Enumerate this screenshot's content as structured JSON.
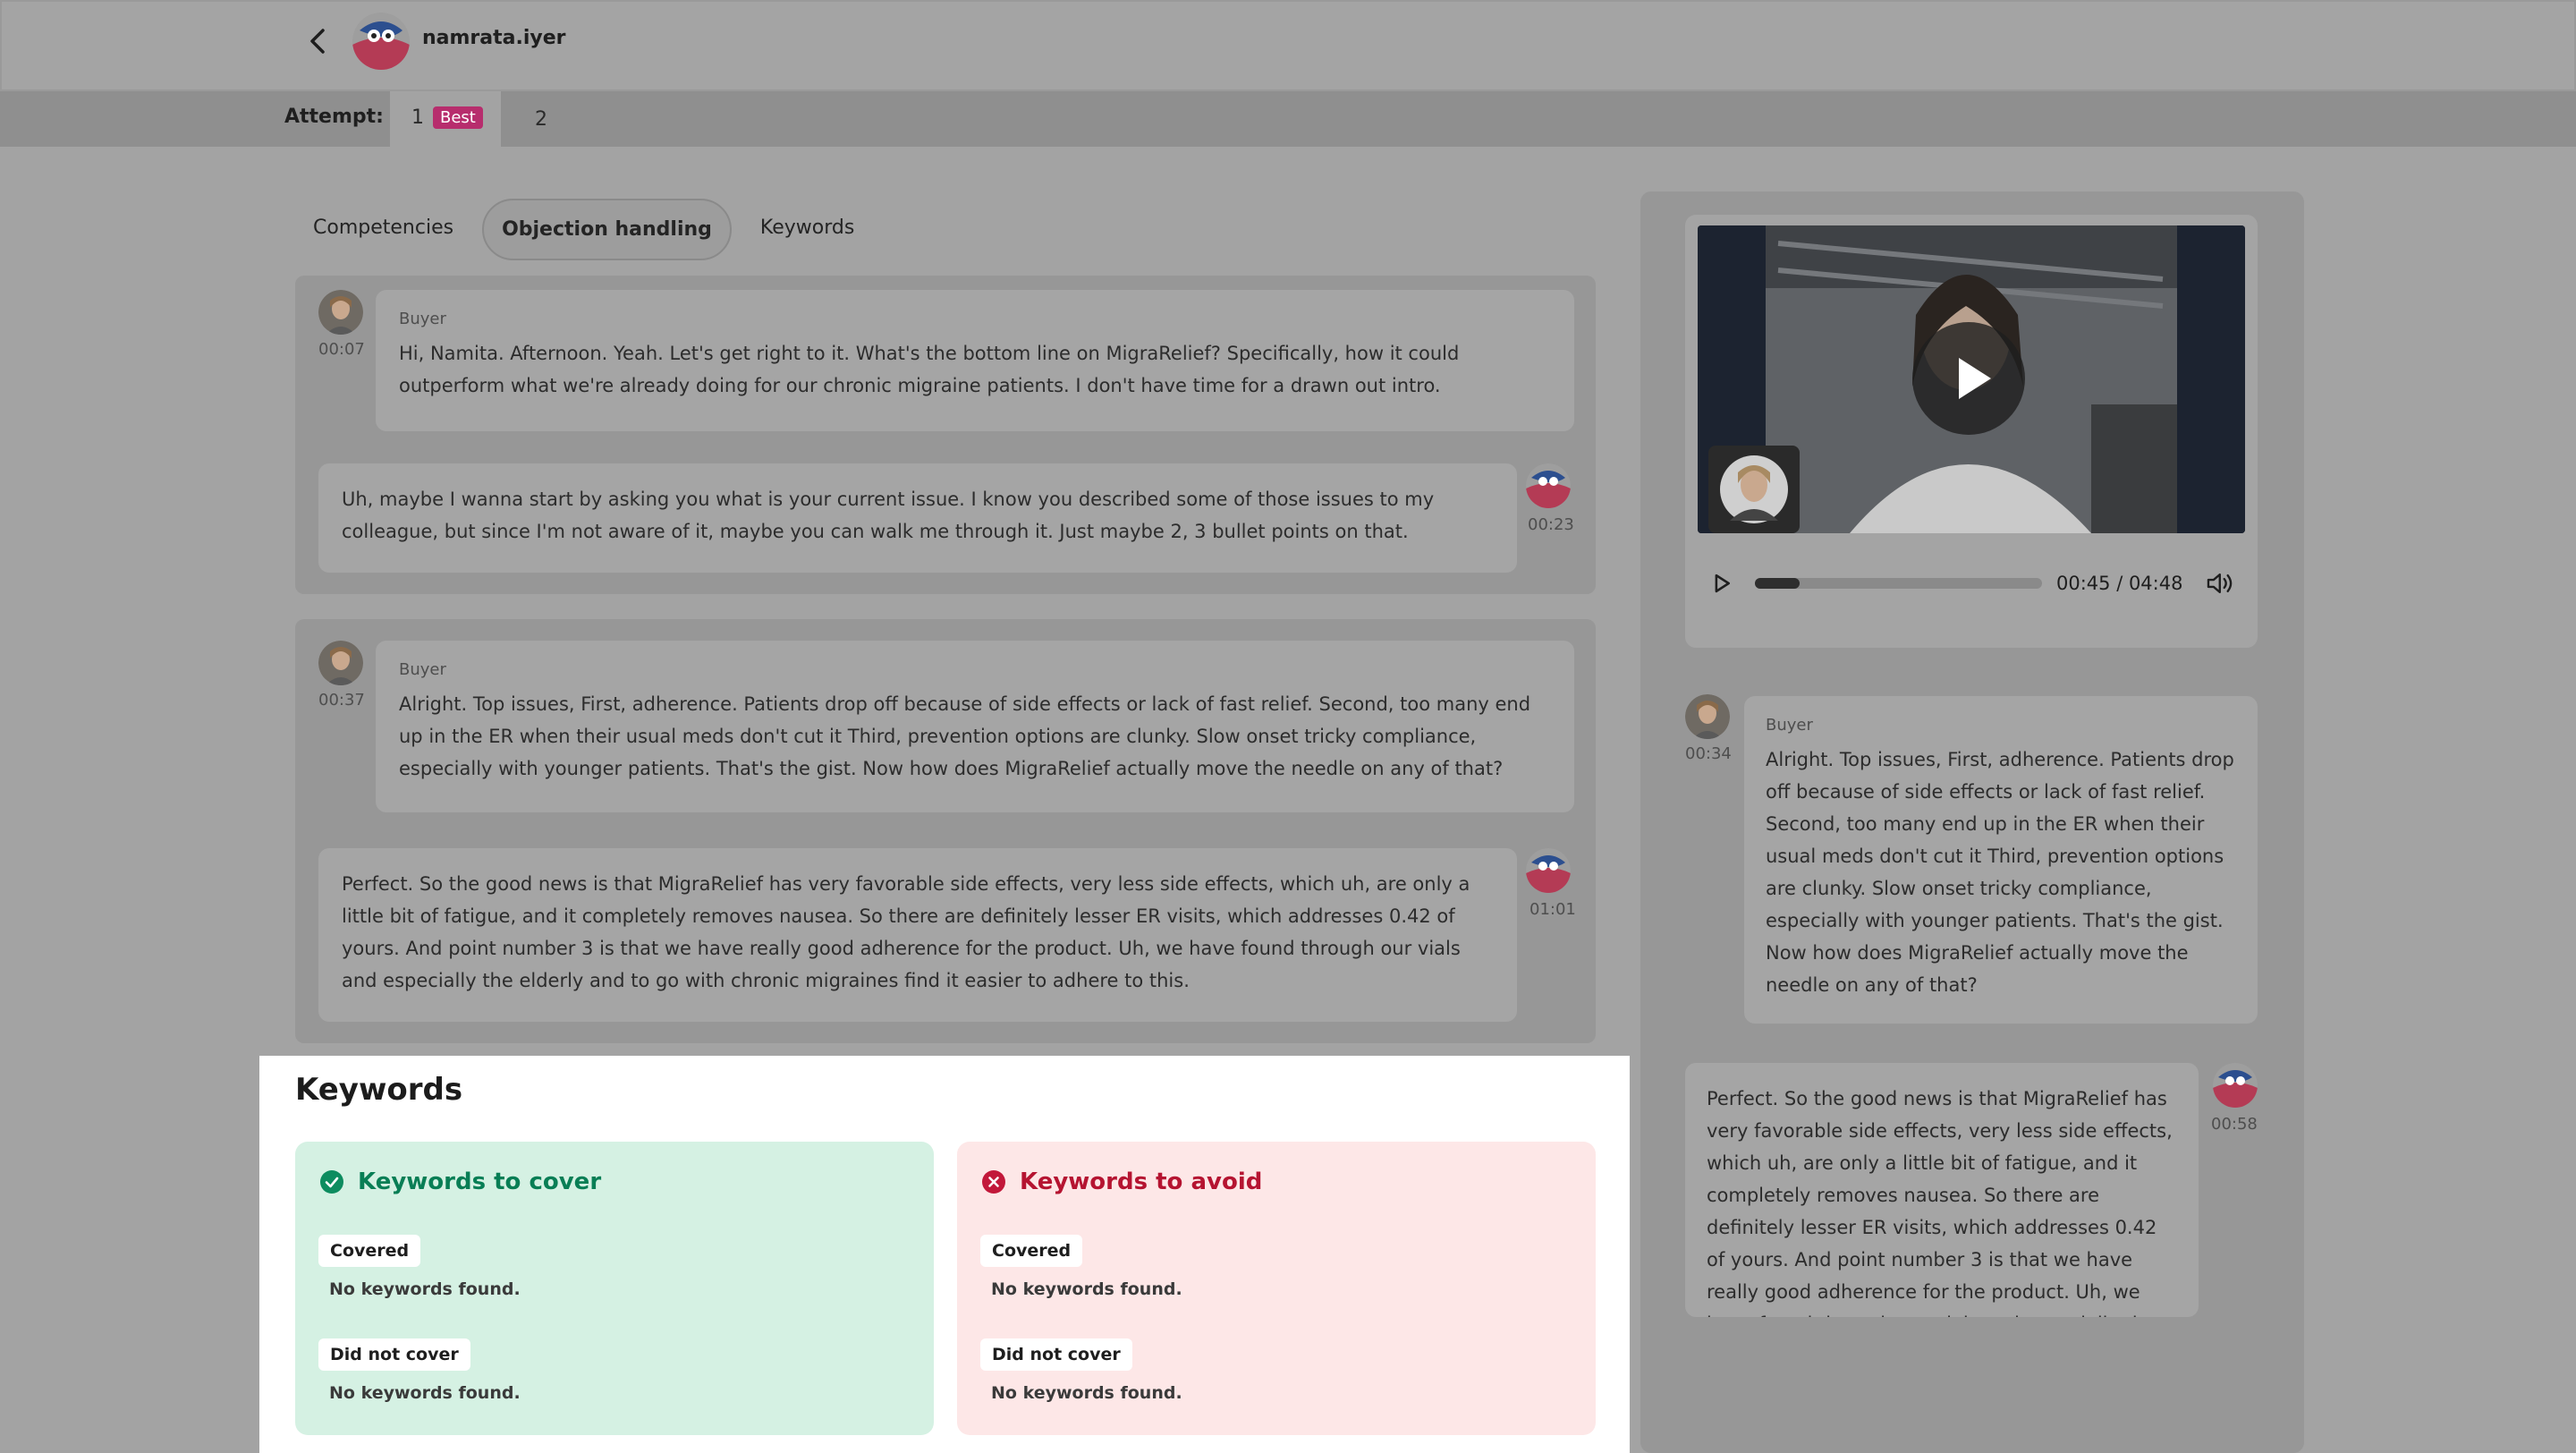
{
  "header": {
    "user_name": "namrata.iyer"
  },
  "attempts": {
    "label": "Attempt:",
    "items": [
      {
        "number": "1",
        "badge": "Best"
      },
      {
        "number": "2"
      }
    ]
  },
  "tabs": [
    "Competencies",
    "Objection handling",
    "Keywords"
  ],
  "transcript": [
    {
      "speaker": "Buyer",
      "time": "00:07",
      "text": "Hi, Namita. Afternoon. Yeah. Let's get right to it. What's the bottom line on MigraRelief? Specifically, how it could outperform what we're already doing for our chronic migraine patients. I don't have time for a drawn out intro."
    },
    {
      "time": "00:23",
      "text": "Uh, maybe I wanna start by asking you what is your current issue. I know you described some of those issues to my colleague, but since I'm not aware of it, maybe you can walk me through it. Just maybe 2, 3 bullet points on that."
    },
    {
      "speaker": "Buyer",
      "time": "00:37",
      "text": "Alright. Top issues, First, adherence. Patients drop off because of side effects or lack of fast relief. Second, too many end up in the ER when their usual meds don't cut it Third, prevention options are clunky. Slow onset tricky compliance, especially with younger patients. That's the gist. Now how does MigraRelief actually move the needle on any of that?"
    },
    {
      "time": "01:01",
      "text": "Perfect. So the good news is that MigraRelief has very favorable side effects, very less side effects, which uh, are only a little bit of fatigue, and it completely removes nausea. So there are definitely lesser ER visits, which addresses 0.42 of yours. And point number 3 is that we have really good adherence for the product. Uh, we have found through our vials and especially the elderly and to go with chronic migraines find it easier to adhere to this."
    }
  ],
  "keywords": {
    "title": "Keywords",
    "cover": {
      "title": "Keywords to cover",
      "covered_label": "Covered",
      "covered_empty": "No keywords found.",
      "not_label": "Did not cover",
      "not_empty": "No keywords found."
    },
    "avoid": {
      "title": "Keywords to avoid",
      "covered_label": "Covered",
      "covered_empty": "No keywords found.",
      "not_label": "Did not cover",
      "not_empty": "No keywords found."
    }
  },
  "player": {
    "time": "00:45 / 04:48",
    "progress": 0.156
  },
  "side_transcript": [
    {
      "speaker": "Buyer",
      "time": "00:34",
      "text": "Alright. Top issues, First, adherence. Patients drop off because of side effects or lack of fast relief. Second, too many end up in the ER when their usual meds don't cut it Third, prevention options are clunky. Slow onset tricky compliance, especially with younger patients. That's the gist. Now how does MigraRelief actually move the needle on any of that?"
    },
    {
      "time": "00:58",
      "text": "Perfect. So the good news is that MigraRelief has very favorable side effects, very less side effects, which uh, are only a little bit of fatigue, and it completely removes nausea. So there are definitely lesser ER visits, which addresses 0.42 of yours. And point number 3 is that we have really good adherence for the product. Uh, we have found through our vials and especially the elderly and to"
    }
  ],
  "colors": {
    "brand": "#b72d6d",
    "cover_accent": "#087e55",
    "avoid_accent": "#b51431"
  },
  "icons": {
    "back": "chevron-left-icon",
    "play": "play-icon",
    "volume": "volume-icon",
    "check": "check-circle-icon",
    "x": "x-circle-icon"
  }
}
